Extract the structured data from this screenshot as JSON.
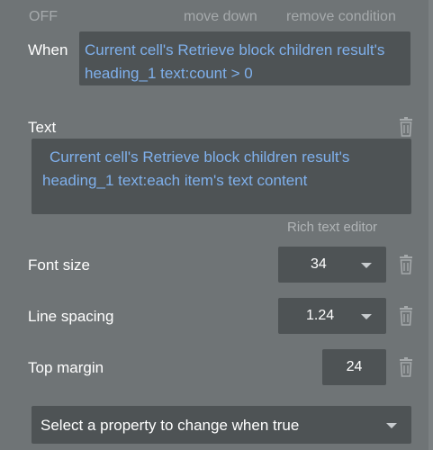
{
  "header": {
    "off_label": "OFF",
    "move_down_label": "move down",
    "remove_condition_label": "remove condition"
  },
  "condition": {
    "when_label": "When",
    "expression": "Current cell's Retrieve block children result's heading_1 text:count > 0"
  },
  "text_property": {
    "label": "Text",
    "value": "Current cell's Retrieve block children result's heading_1 text:each item's text content",
    "rich_text_editor_label": "Rich text editor"
  },
  "font_size": {
    "label": "Font size",
    "value": "34"
  },
  "line_spacing": {
    "label": "Line spacing",
    "value": "1.24"
  },
  "top_margin": {
    "label": "Top margin",
    "value": "24"
  },
  "property_select": {
    "placeholder": "Select a property to change when true"
  },
  "icons": {
    "delete": "trash-icon",
    "dropdown": "chevron-down-icon"
  },
  "colors": {
    "panel_bg": "#6f7476",
    "field_bg": "#4e5355",
    "dynamic_text": "#7fb0ec",
    "muted_text": "#a6aaac"
  }
}
